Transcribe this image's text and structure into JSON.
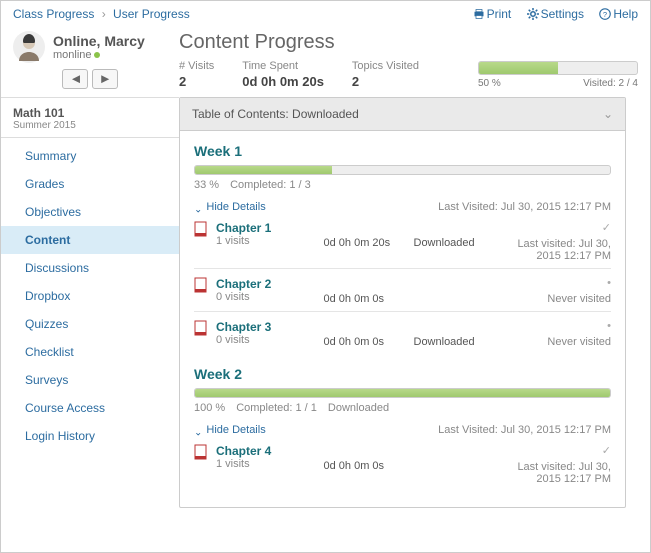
{
  "breadcrumb": {
    "root": "Class Progress",
    "current": "User Progress"
  },
  "actions": {
    "print": "Print",
    "settings": "Settings",
    "help": "Help"
  },
  "user": {
    "name": "Online, Marcy",
    "login": "monline"
  },
  "page_title": "Content Progress",
  "stats": {
    "visits": {
      "label": "# Visits",
      "value": "2"
    },
    "time": {
      "label": "Time Spent",
      "value": "0d 0h 0m 20s"
    },
    "topics": {
      "label": "Topics Visited",
      "value": "2"
    }
  },
  "overall": {
    "percent_label": "50 %",
    "percent": 50,
    "visited_label": "Visited: 2 / 4"
  },
  "course": {
    "title": "Math 101",
    "term": "Summer 2015"
  },
  "nav": [
    "Summary",
    "Grades",
    "Objectives",
    "Content",
    "Discussions",
    "Dropbox",
    "Quizzes",
    "Checklist",
    "Surveys",
    "Course Access",
    "Login History"
  ],
  "nav_active": "Content",
  "toc_header": "Table of Contents: Downloaded",
  "weeks": [
    {
      "title": "Week 1",
      "percent": 33,
      "percent_label": "33 %",
      "completed_label": "Completed: 1 / 3",
      "downloaded": "",
      "hide": "Hide Details",
      "last_visited": "Last Visited: Jul 30, 2015 12:17 PM",
      "chapters": [
        {
          "title": "Chapter 1",
          "visits": "1 visits",
          "time": "0d 0h 0m 20s",
          "status": "Downloaded",
          "check": true,
          "last": "Last visited: Jul 30, 2015 12:17 PM"
        },
        {
          "title": "Chapter 2",
          "visits": "0 visits",
          "time": "0d 0h 0m 0s",
          "status": "",
          "check": false,
          "last": "Never visited"
        },
        {
          "title": "Chapter 3",
          "visits": "0 visits",
          "time": "0d 0h 0m 0s",
          "status": "Downloaded",
          "check": false,
          "last": "Never visited"
        }
      ]
    },
    {
      "title": "Week 2",
      "percent": 100,
      "percent_label": "100 %",
      "completed_label": "Completed: 1 / 1",
      "downloaded": "Downloaded",
      "hide": "Hide Details",
      "last_visited": "Last Visited: Jul 30, 2015 12:17 PM",
      "chapters": [
        {
          "title": "Chapter 4",
          "visits": "1 visits",
          "time": "0d 0h 0m 0s",
          "status": "",
          "check": true,
          "last": "Last visited: Jul 30, 2015 12:17 PM"
        }
      ]
    }
  ]
}
